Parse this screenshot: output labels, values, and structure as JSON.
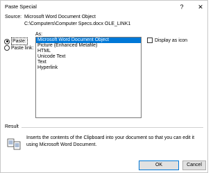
{
  "window": {
    "title": "Paste Special",
    "help_glyph": "?",
    "close_glyph": "✕"
  },
  "source": {
    "label": "Source:",
    "line1": "Microsoft Word Document Object",
    "line2": "C:\\Computers\\Computer Specs.docx OLE_LINK1"
  },
  "as_label": "As:",
  "options": {
    "paste_label": "Paste:",
    "paste_link_label": "Paste link:",
    "selected": "paste"
  },
  "list": {
    "items": [
      "Microsoft Word Document Object",
      "Picture (Enhanced Metafile)",
      "HTML",
      "Unicode Text",
      "Text",
      "Hyperlink"
    ],
    "selected_index": 0
  },
  "display_as_icon": {
    "label": "Display as icon",
    "checked": false
  },
  "result": {
    "title": "Result",
    "text": "Inserts the contents of the Clipboard into your document so that you can edit it using Microsoft Word Document."
  },
  "buttons": {
    "ok": "OK",
    "cancel": "Cancel"
  },
  "colors": {
    "selection": "#0078d7",
    "button_bg": "#e1e1e1"
  }
}
